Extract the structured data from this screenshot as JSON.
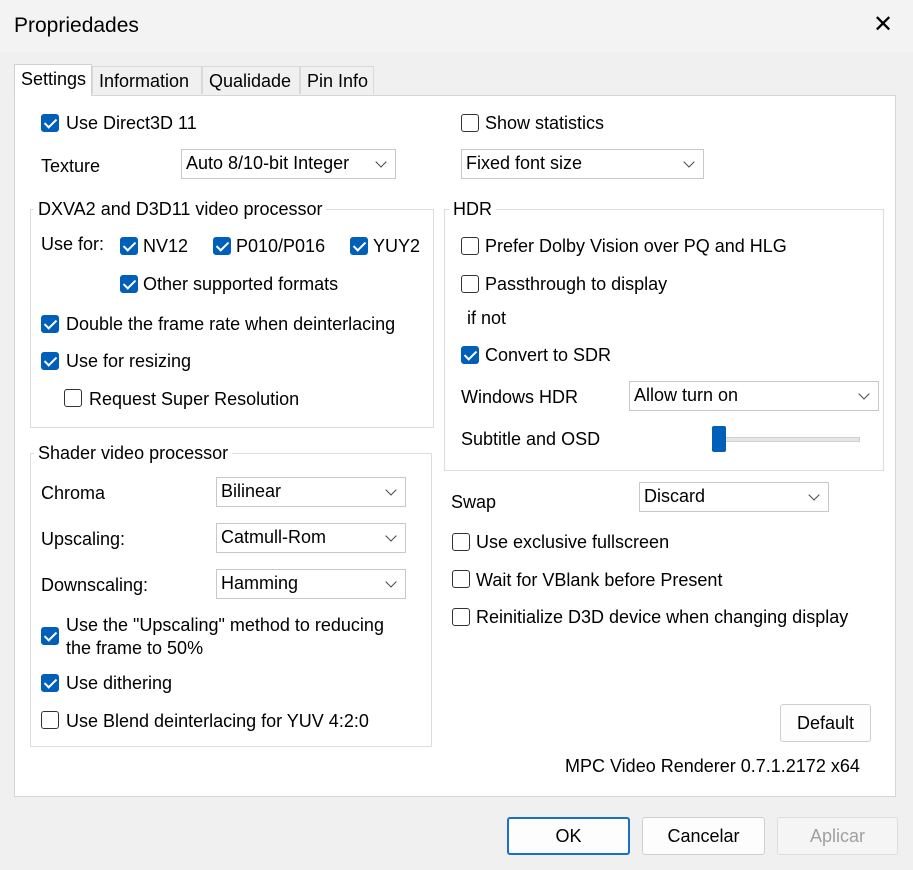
{
  "window": {
    "title": "Propriedades",
    "close_glyph": "✕"
  },
  "tabs": [
    {
      "label": "Settings",
      "active": true
    },
    {
      "label": "Information",
      "active": false
    },
    {
      "label": "Qualidade",
      "active": false
    },
    {
      "label": "Pin Info",
      "active": false
    }
  ],
  "left": {
    "use_d3d11": {
      "label": "Use Direct3D 11",
      "checked": true
    },
    "texture": {
      "label": "Texture",
      "value": "Auto 8/10-bit Integer"
    },
    "dxva": {
      "title": "DXVA2 and D3D11 video processor",
      "use_for": "Use for:",
      "nv12": {
        "label": "NV12",
        "checked": true
      },
      "p010": {
        "label": "P010/P016",
        "checked": true
      },
      "yuy2": {
        "label": "YUY2",
        "checked": true
      },
      "other": {
        "label": "Other supported formats",
        "checked": true
      },
      "double_rate": {
        "label": "Double the frame rate when deinterlacing",
        "checked": true
      },
      "resizing": {
        "label": "Use for resizing",
        "checked": true
      },
      "super_res": {
        "label": "Request Super Resolution",
        "checked": false
      }
    },
    "shader": {
      "title": "Shader video processor",
      "chroma": {
        "label": "Chroma",
        "value": "Bilinear"
      },
      "upscaling": {
        "label": "Upscaling:",
        "value": "Catmull-Rom"
      },
      "downscaling": {
        "label": "Downscaling:",
        "value": "Hamming"
      },
      "upscale_method": {
        "line1": "Use the \"Upscaling\" method to reducing",
        "line2": "the frame to 50%",
        "checked": true
      },
      "dithering": {
        "label": "Use dithering",
        "checked": true
      },
      "blend": {
        "label": "Use Blend deinterlacing for YUV 4:2:0",
        "checked": false
      }
    }
  },
  "right": {
    "show_stats": {
      "label": "Show statistics",
      "checked": false
    },
    "font_size": {
      "value": "Fixed font size"
    },
    "hdr": {
      "title": "HDR",
      "dolby": {
        "label": "Prefer Dolby Vision over PQ and HLG",
        "checked": false
      },
      "passthrough": {
        "label": "Passthrough to display",
        "checked": false
      },
      "if_not": "if not",
      "convert": {
        "label": "Convert to SDR",
        "checked": true
      },
      "windows_hdr": {
        "label": "Windows HDR",
        "value": "Allow turn on"
      },
      "subtitle_osd": {
        "label": "Subtitle and OSD",
        "level": 0
      }
    },
    "swap": {
      "label": "Swap",
      "value": "Discard"
    },
    "exclusive": {
      "label": "Use exclusive fullscreen",
      "checked": false
    },
    "vblank": {
      "label": "Wait for VBlank before Present",
      "checked": false
    },
    "reinit": {
      "label": "Reinitialize D3D device when changing display",
      "checked": false
    },
    "default_button": "Default",
    "version": "MPC Video Renderer 0.7.1.2172 x64"
  },
  "footer": {
    "ok": "OK",
    "cancel": "Cancelar",
    "apply": "Aplicar"
  }
}
